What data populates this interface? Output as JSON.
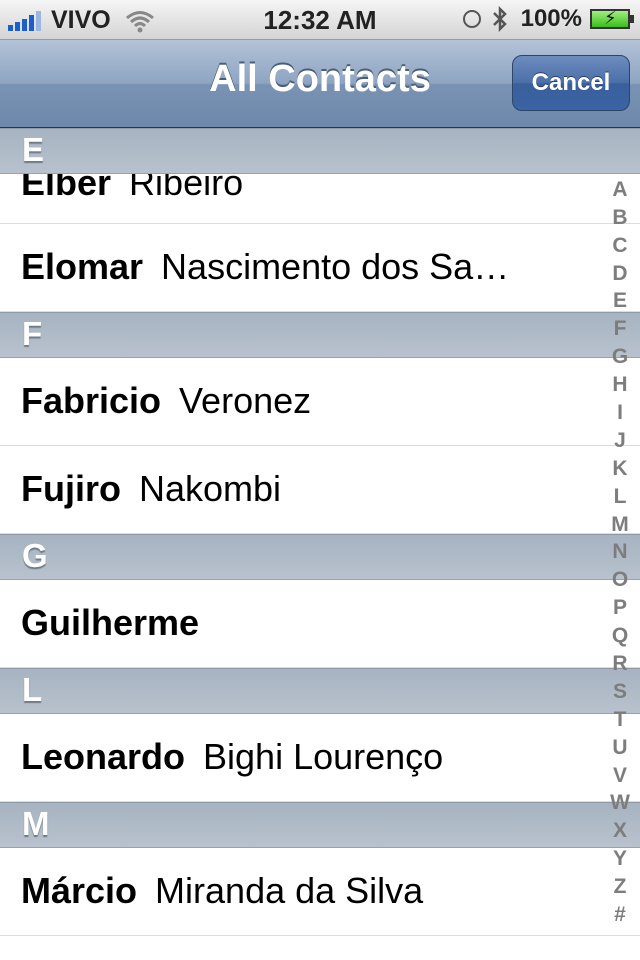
{
  "status_bar": {
    "carrier": "VIVO",
    "time": "12:32 AM",
    "battery": "100%"
  },
  "nav": {
    "title": "All Contacts",
    "cancel_label": "Cancel"
  },
  "sections": [
    {
      "letter": "E"
    },
    {
      "letter": "F"
    },
    {
      "letter": "G"
    },
    {
      "letter": "L"
    },
    {
      "letter": "M"
    }
  ],
  "contacts": [
    {
      "first": "Elber",
      "last": "Ribeiro"
    },
    {
      "first": "Elomar",
      "last": "Nascimento dos Sa…"
    },
    {
      "first": "Fabricio",
      "last": "Veronez"
    },
    {
      "first": "Fujiro",
      "last": "Nakombi"
    },
    {
      "first": "Guilherme",
      "last": ""
    },
    {
      "first": "Leonardo",
      "last": "Bighi Lourenço"
    },
    {
      "first": "Márcio",
      "last": "Miranda da Silva"
    }
  ],
  "index": [
    "A",
    "B",
    "C",
    "D",
    "E",
    "F",
    "G",
    "H",
    "I",
    "J",
    "K",
    "L",
    "M",
    "N",
    "O",
    "P",
    "Q",
    "R",
    "S",
    "T",
    "U",
    "V",
    "W",
    "X",
    "Y",
    "Z",
    "#"
  ]
}
